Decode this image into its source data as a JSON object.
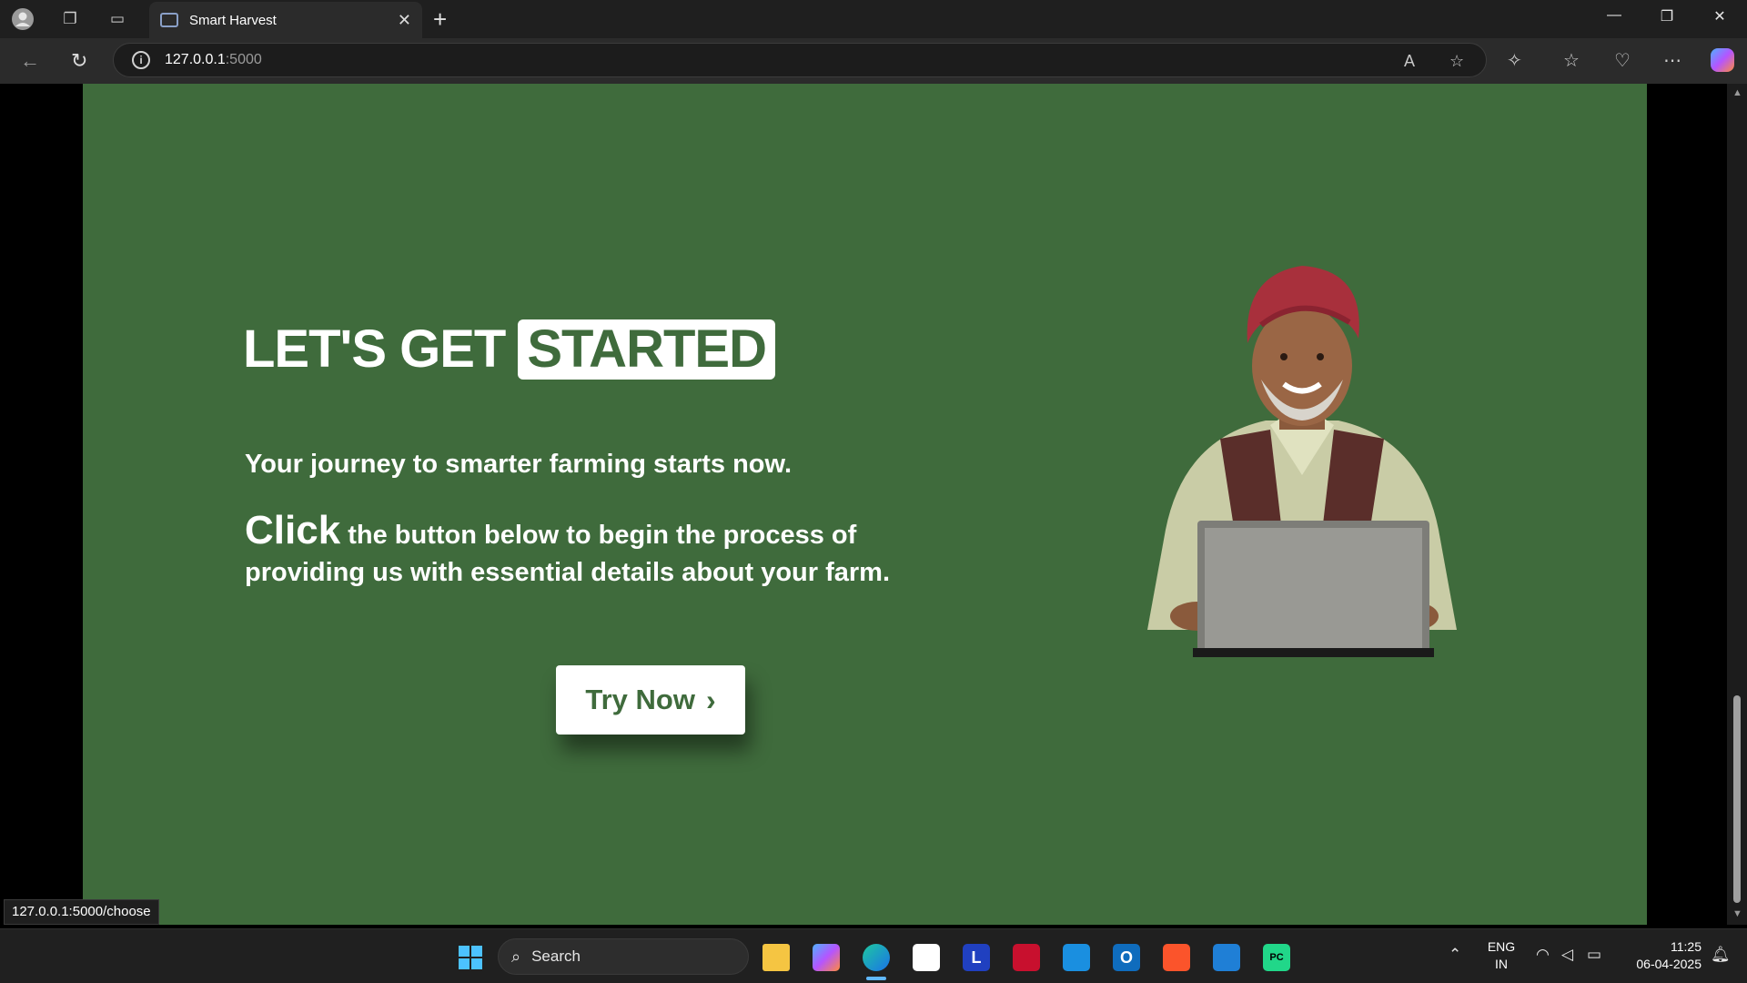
{
  "browser": {
    "tab_title": "Smart Harvest",
    "url_host": "127.0.0.1",
    "url_port": ":5000",
    "status_url": "127.0.0.1:5000/choose"
  },
  "hero": {
    "title_prefix": "LET'S GET",
    "title_highlight": "STARTED",
    "lead": "Your journey to smarter farming starts now.",
    "click_word": "Click",
    "description": " the button below to begin the process of providing us with essential details about your farm.",
    "cta_label": "Try Now",
    "illustration": "farmer-with-laptop"
  },
  "taskbar": {
    "search_label": "Search",
    "language": "ENG",
    "region": "IN",
    "time": "11:25",
    "date": "06-04-2025"
  },
  "colors": {
    "page_bg": "#3f6b3c",
    "accent": "#ffffff"
  }
}
